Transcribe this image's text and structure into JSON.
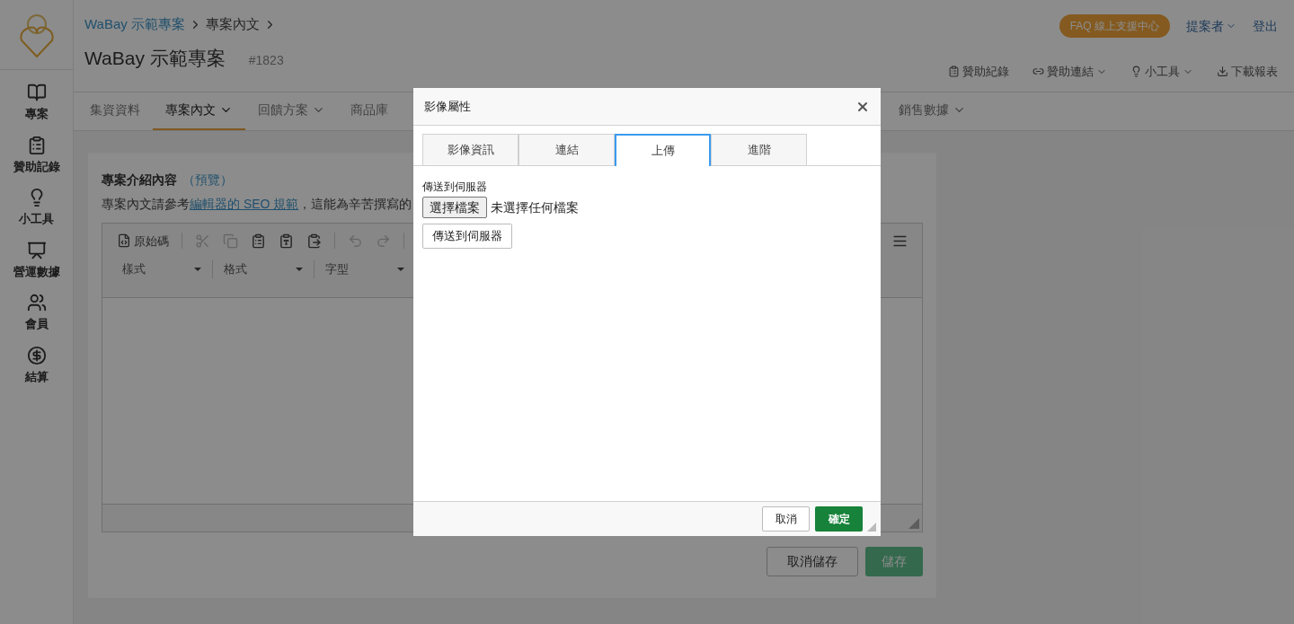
{
  "sidebar": {
    "items": [
      {
        "label": "專案"
      },
      {
        "label": "贊助記錄"
      },
      {
        "label": "小工具"
      },
      {
        "label": "營運數據"
      },
      {
        "label": "會員"
      },
      {
        "label": "結算"
      }
    ]
  },
  "header": {
    "breadcrumb": [
      "WaBay 示範專案",
      "專案內文"
    ],
    "title": "WaBay 示範專案",
    "project_id": "#1823",
    "faq": "FAQ 線上支援中心",
    "user": "提案者",
    "logout": "登出",
    "actions": [
      {
        "label": "贊助紀錄",
        "dropdown": false
      },
      {
        "label": "贊助連結",
        "dropdown": true
      },
      {
        "label": "小工具",
        "dropdown": true
      },
      {
        "label": "下載報表",
        "dropdown": false
      }
    ]
  },
  "tabs": [
    {
      "label": "集資資料",
      "selected": false,
      "dropdown": false
    },
    {
      "label": "專案內文",
      "selected": true,
      "dropdown": true
    },
    {
      "label": "回饋方案",
      "selected": false,
      "dropdown": true
    },
    {
      "label": "商品庫",
      "selected": false,
      "dropdown": false
    },
    {
      "label": "銷售數據",
      "selected": false,
      "dropdown": true
    }
  ],
  "card": {
    "title": "專案介紹內容",
    "preview": "（預覽）",
    "description": {
      "before": "專案內文請參考",
      "link": "編輯器的 SEO 規範",
      "after": "，這能為辛苦撰寫的"
    },
    "editor": {
      "source_label": "原始碼",
      "combos": [
        "樣式",
        "格式",
        "字型"
      ]
    },
    "cancel_button": "取消儲存",
    "save_button": "儲存"
  },
  "dialog": {
    "title": "影像屬性",
    "tabs": [
      {
        "label": "影像資訊",
        "selected": false
      },
      {
        "label": "連結",
        "selected": false
      },
      {
        "label": "上傳",
        "selected": true
      },
      {
        "label": "進階",
        "selected": false
      }
    ],
    "upload_label": "傳送到伺服器",
    "choose_button": "選擇檔案",
    "no_file": "未選擇任何檔案",
    "send_button": "傳送到伺服器",
    "cancel_button": "取消",
    "ok_button": "確定"
  }
}
